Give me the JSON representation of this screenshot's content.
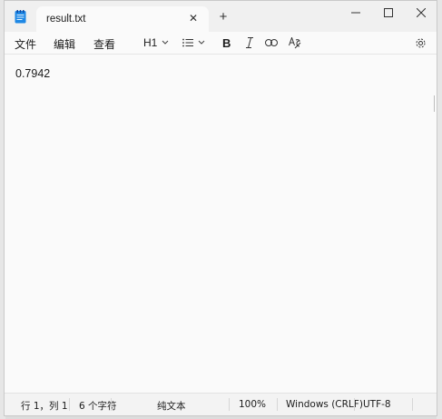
{
  "window": {
    "tab_title": "result.txt",
    "tab_close_icon": "close-icon",
    "new_tab_icon": "plus-icon",
    "controls": [
      "minimize-icon",
      "maximize-icon",
      "close-icon"
    ]
  },
  "menu": {
    "file": "文件",
    "edit": "编辑",
    "view": "查看"
  },
  "toolbar": {
    "heading": "H1",
    "list_icon": "list-icon",
    "bold": "B",
    "italic_icon": "italic-icon",
    "link_icon": "link-icon",
    "format_icon": "clear-format-icon",
    "settings_icon": "gear-icon"
  },
  "editor": {
    "content": "0.7942"
  },
  "status": {
    "position": "行 1，列 1",
    "char_count": "6 个字符",
    "mode": "纯文本",
    "zoom": "100%",
    "line_ending": "Windows (CRLF)",
    "encoding": "UTF-8"
  },
  "colors": {
    "background": "#fafafa",
    "titlebar": "#f0f0f0",
    "app_icon": "#1e88e5"
  }
}
